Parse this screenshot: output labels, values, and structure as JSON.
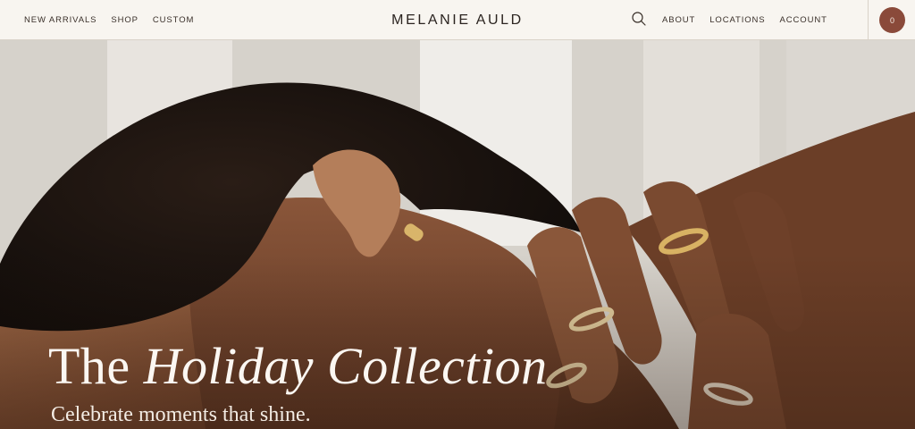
{
  "brand": {
    "logo_text": "MELANIE AULD"
  },
  "nav_left": [
    {
      "label": "NEW ARRIVALS"
    },
    {
      "label": "SHOP"
    },
    {
      "label": "CUSTOM"
    }
  ],
  "nav_right": [
    {
      "label": "ABOUT"
    },
    {
      "label": "LOCATIONS"
    },
    {
      "label": "ACCOUNT"
    }
  ],
  "icons": {
    "search": "search-icon"
  },
  "cart": {
    "count": "0"
  },
  "hero": {
    "title_plain": "The",
    "title_italic": "Holiday Collection",
    "subtitle": "Celebrate moments that shine."
  },
  "colors": {
    "header_bg": "#f8f5f0",
    "cart_badge": "#8a4a3a",
    "text_dark": "#3a302a"
  }
}
